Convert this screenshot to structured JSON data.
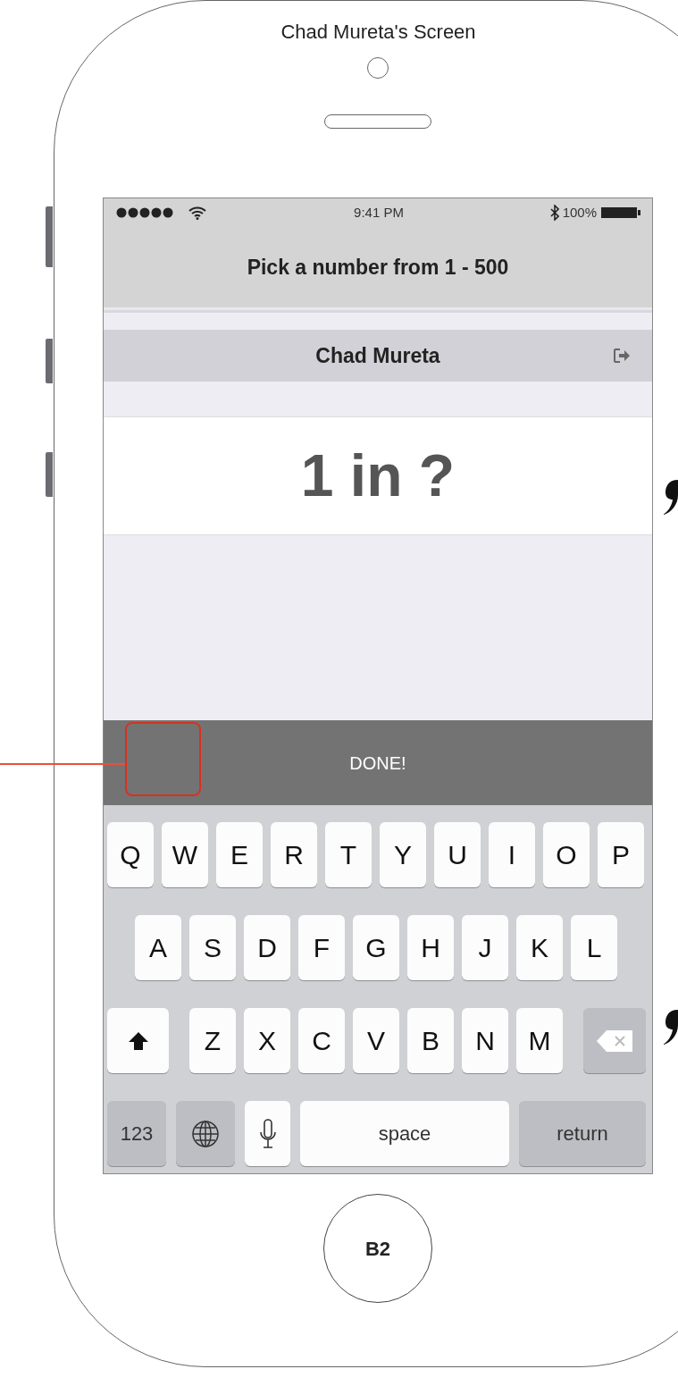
{
  "phone": {
    "title": "Chad Mureta's Screen",
    "home_button": "B2"
  },
  "status_bar": {
    "time": "9:41 PM",
    "battery": "100%"
  },
  "header": {
    "title": "Pick a number from 1 - 500"
  },
  "user_bar": {
    "name": "Chad Mureta"
  },
  "odds": {
    "text": "1 in ?"
  },
  "done_button": {
    "label": "DONE!"
  },
  "keyboard": {
    "top_row": [
      {
        "kind": "letter",
        "label": "Q"
      },
      {
        "kind": "letter",
        "label": "W"
      },
      {
        "kind": "letter",
        "label": "E"
      },
      {
        "kind": "letter",
        "label": "R"
      },
      {
        "kind": "letter",
        "label": "T"
      },
      {
        "kind": "letter",
        "label": "Y"
      },
      {
        "kind": "letter",
        "label": "U"
      },
      {
        "kind": "letter",
        "label": "I"
      },
      {
        "kind": "letter",
        "label": "O"
      },
      {
        "kind": "letter",
        "label": "P"
      }
    ],
    "middle_row": [
      {
        "kind": "letter",
        "label": "A"
      },
      {
        "kind": "letter",
        "label": "S"
      },
      {
        "kind": "letter",
        "label": "D"
      },
      {
        "kind": "letter",
        "label": "F"
      },
      {
        "kind": "letter",
        "label": "G"
      },
      {
        "kind": "letter",
        "label": "H"
      },
      {
        "kind": "letter",
        "label": "J"
      },
      {
        "kind": "letter",
        "label": "K"
      },
      {
        "kind": "letter",
        "label": "L"
      }
    ],
    "lower_row": [
      {
        "kind": "shift"
      },
      {
        "kind": "letter",
        "label": "Z"
      },
      {
        "kind": "letter",
        "label": "X"
      },
      {
        "kind": "letter",
        "label": "C"
      },
      {
        "kind": "letter",
        "label": "V"
      },
      {
        "kind": "letter",
        "label": "B"
      },
      {
        "kind": "letter",
        "label": "N"
      },
      {
        "kind": "letter",
        "label": "M"
      },
      {
        "kind": "delete"
      }
    ],
    "bottom_row": [
      {
        "kind": "numbers",
        "label": "123"
      },
      {
        "kind": "globe"
      },
      {
        "kind": "mic"
      },
      {
        "kind": "space",
        "label": "space"
      },
      {
        "kind": "return",
        "label": "return"
      }
    ]
  }
}
